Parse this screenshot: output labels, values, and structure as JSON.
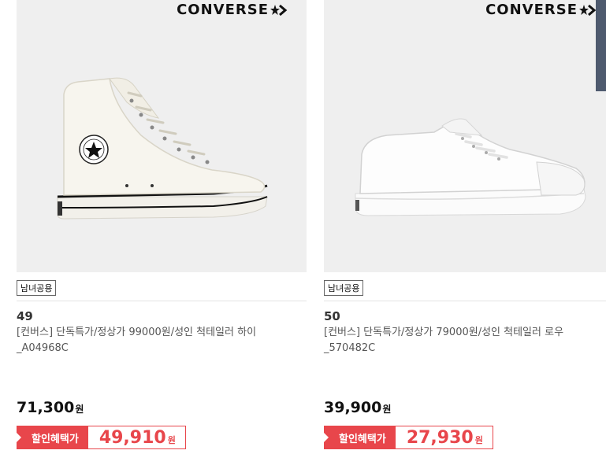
{
  "products": [
    {
      "brand": "CONVERSE",
      "badge": "남녀공용",
      "rank": "49",
      "title": "[컨버스] 단독특가/정상가 99000원/성인 척테일러 하이_A04968C",
      "price": "71,300",
      "price_unit": "원",
      "discount_label": "할인혜택가",
      "discount_price": "49,910",
      "discount_unit": "원",
      "image_icon": "high-top-sneaker-image"
    },
    {
      "brand": "CONVERSE",
      "badge": "남녀공용",
      "rank": "50",
      "title": "[컨버스] 단독특가/정상가 79000원/성인 척테일러 로우_570482C",
      "price": "39,900",
      "price_unit": "원",
      "discount_label": "할인혜택가",
      "discount_price": "27,930",
      "discount_unit": "원",
      "image_icon": "low-top-sneaker-image"
    }
  ],
  "colors": {
    "accent": "#e8464b",
    "image_bg": "#efefef",
    "scrollbar": "#4e5a6e"
  }
}
